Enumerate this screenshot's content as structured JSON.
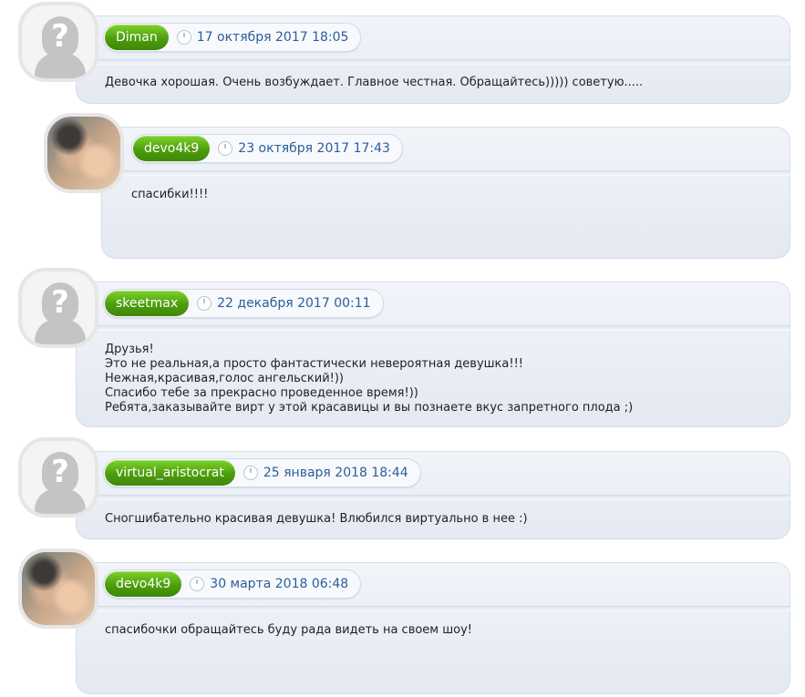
{
  "comments": [
    {
      "user": "Diman",
      "date": "17 октября 2017 18:05",
      "avatar": "question-placeholder",
      "text": "Девочка хорошая. Очень возбуждает. Главное честная. Обращайтесь))))) советую....."
    },
    {
      "user": "devo4k9",
      "date": "23 октября 2017 17:43",
      "avatar": "photo",
      "text": "спасибки!!!!"
    },
    {
      "user": "skeetmax",
      "date": "22 декабря 2017 00:11",
      "avatar": "question-placeholder",
      "text": "Друзья!\nЭто не реальная,а просто фантастически невероятная девушка!!!\nНежная,красивая,голос ангельский!))\nСпасибо тебе за прекрасно проведенное время!))\nРебята,заказывайте вирт у этой красавицы и вы познаете вкус запретного плода ;)"
    },
    {
      "user": "virtual_aristocrat",
      "date": "25 января 2018 18:44",
      "avatar": "question-placeholder",
      "text": "Сногшибательно красивая девушка! Влюбился виртуально в нее :)"
    },
    {
      "user": "devo4k9",
      "date": "30 марта 2018 06:48",
      "avatar": "photo",
      "text": "спасибочки обращайтесь буду рада видеть на своем шоу!"
    }
  ],
  "icons": {
    "date": "clock-icon",
    "placeholder": "question-avatar-icon"
  },
  "colors": {
    "user_badge": "#4c9d0c",
    "date_text": "#2b5e9c",
    "card_bg": "#eef2f8"
  }
}
